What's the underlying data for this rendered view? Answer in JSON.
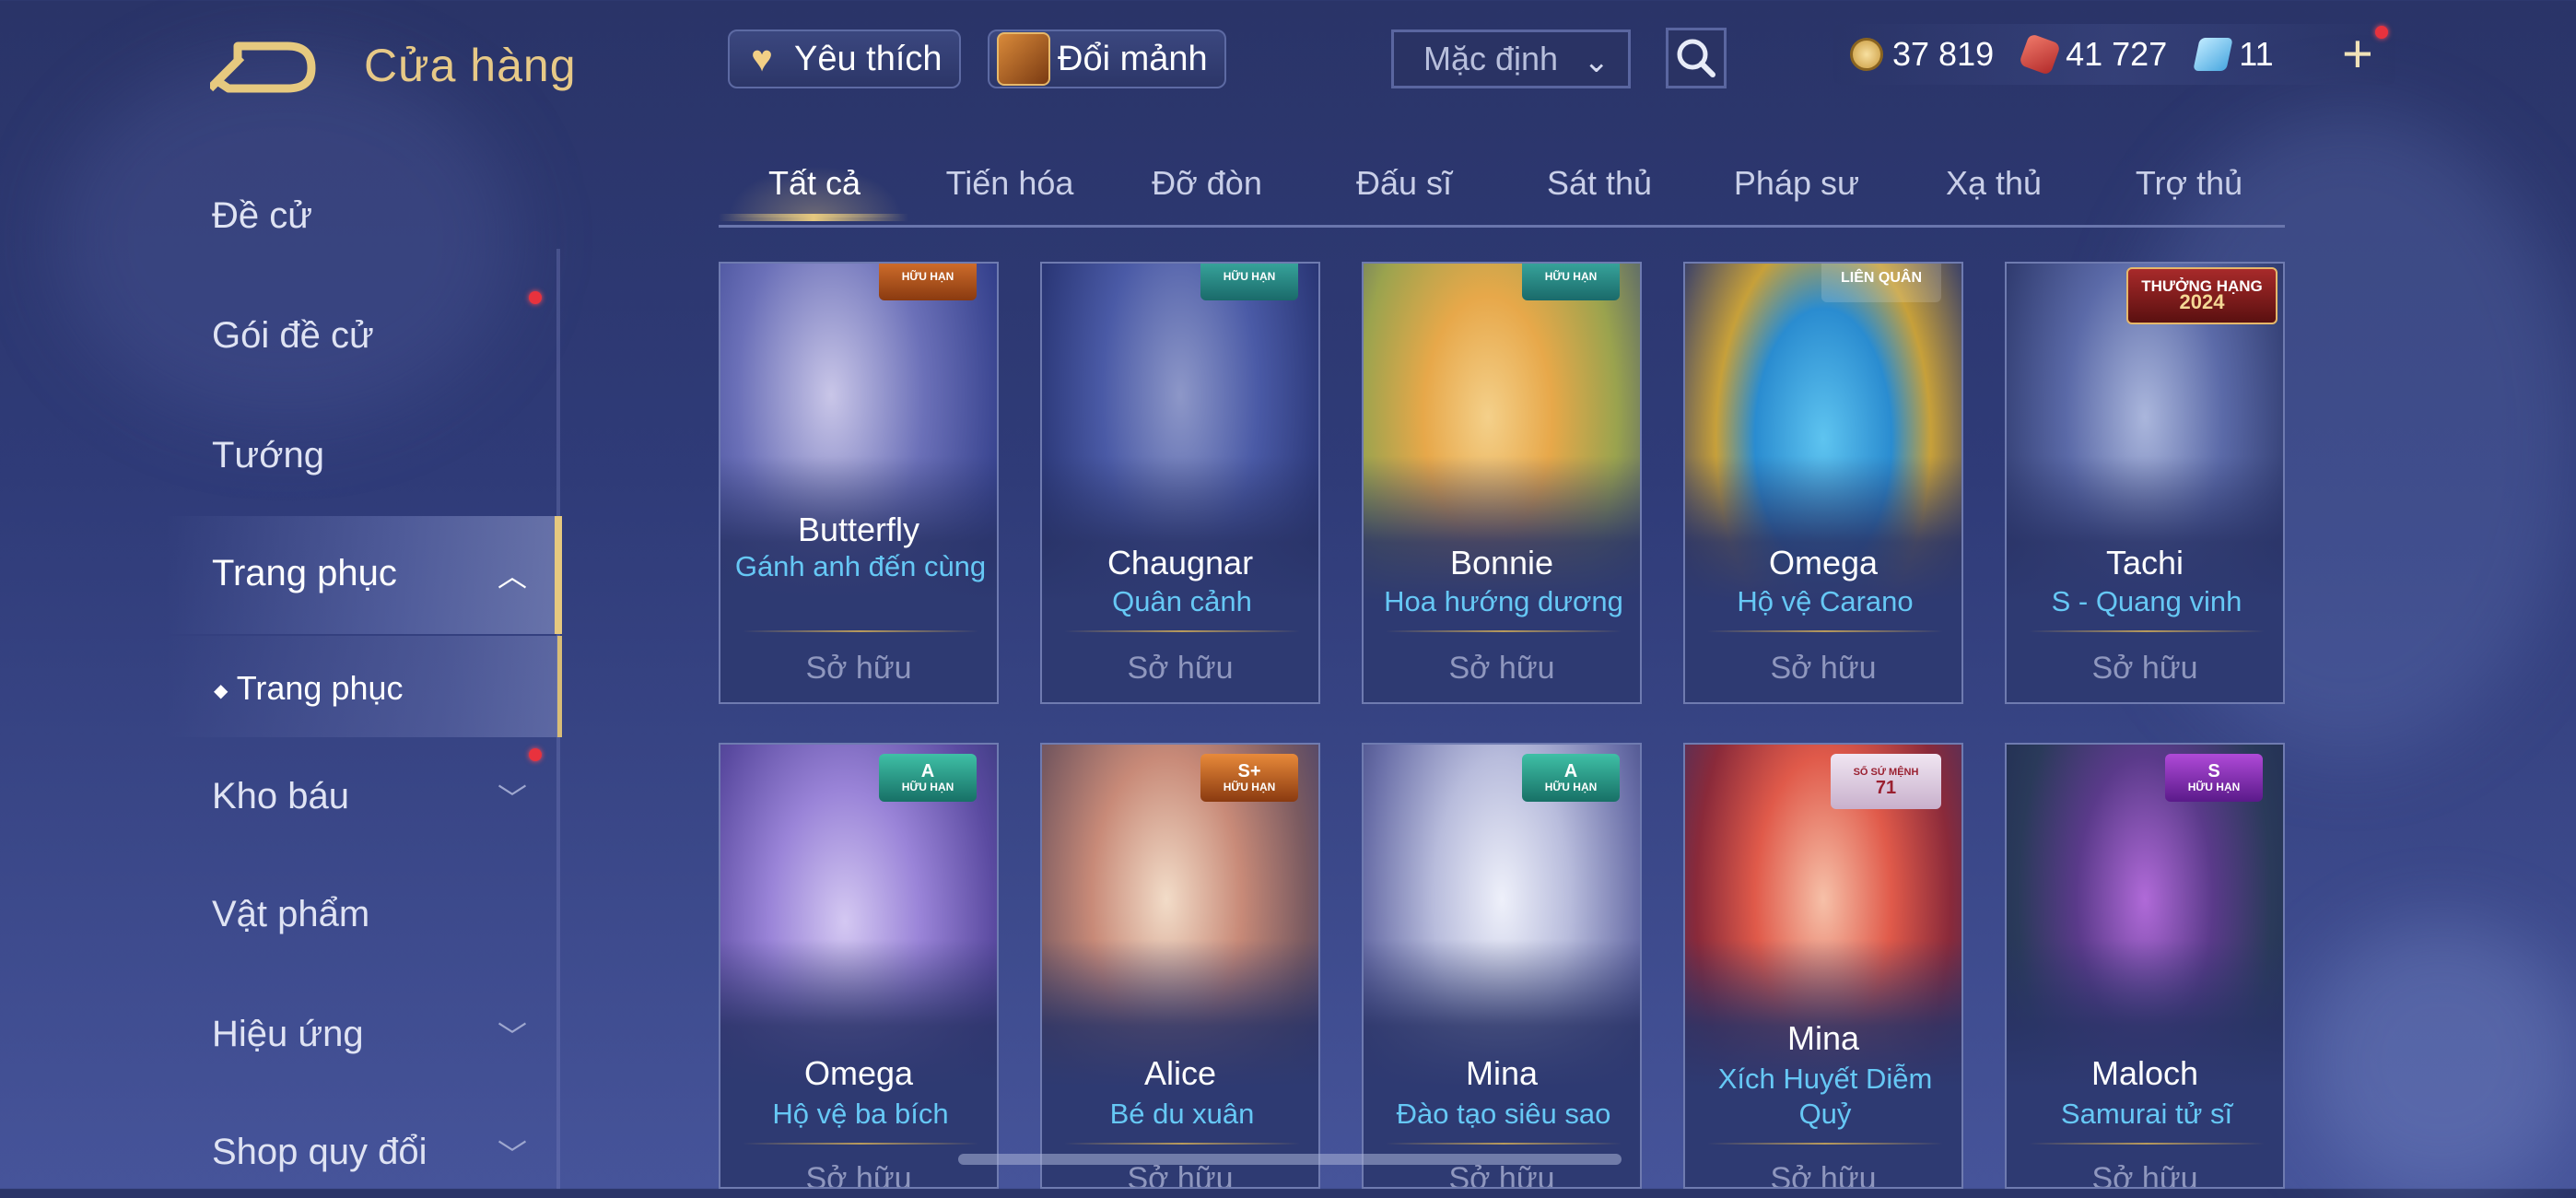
{
  "header": {
    "title": "Cửa hàng",
    "favorite_label": "Yêu thích",
    "exchange_label": "Đổi mảnh",
    "sort_value": "Mặc định"
  },
  "currency": {
    "gold": "37 819",
    "coupons": "41 727",
    "diamonds": "11"
  },
  "sidebar": {
    "items": [
      {
        "label": "Đề cử"
      },
      {
        "label": "Gói đề cử"
      },
      {
        "label": "Tướng"
      },
      {
        "label": "Trang phục"
      },
      {
        "label": "Trang phục"
      },
      {
        "label": "Kho báu"
      },
      {
        "label": "Vật phẩm"
      },
      {
        "label": "Hiệu ứng"
      },
      {
        "label": "Shop quy đổi"
      }
    ]
  },
  "tabs": [
    "Tất cả",
    "Tiến hóa",
    "Đỡ đòn",
    "Đấu sĩ",
    "Sát thủ",
    "Pháp sư",
    "Xạ thủ",
    "Trợ thủ"
  ],
  "cards": [
    {
      "hero": "Butterfly",
      "skin": "Gánh anh đến cùng",
      "status": "Sở hữu",
      "badge_grade": "",
      "badge_text": "HỮU HẠN"
    },
    {
      "hero": "Chaugnar",
      "skin": "Quân cảnh",
      "status": "Sở hữu",
      "badge_grade": "",
      "badge_text": "HỮU HẠN"
    },
    {
      "hero": "Bonnie",
      "skin": "Hoa hướng dương",
      "status": "Sở hữu",
      "badge_grade": "",
      "badge_text": "HỮU HẠN"
    },
    {
      "hero": "Omega",
      "skin": "Hộ vệ Carano",
      "status": "Sở hữu",
      "badge_grade": "",
      "badge_text": "LIÊN QUÂN"
    },
    {
      "hero": "Tachi",
      "skin": "S - Quang vinh",
      "status": "Sở hữu",
      "badge_grade": "THƯỞNG HẠNG",
      "badge_text": "2024"
    },
    {
      "hero": "Omega",
      "skin": "Hộ vệ ba bích",
      "status": "Sở hữu",
      "badge_grade": "A",
      "badge_text": "HỮU HẠN"
    },
    {
      "hero": "Alice",
      "skin": "Bé du xuân",
      "status": "Sở hữu",
      "badge_grade": "S+",
      "badge_text": "HỮU HẠN"
    },
    {
      "hero": "Mina",
      "skin": "Đào tạo siêu sao",
      "status": "Sở hữu",
      "badge_grade": "A",
      "badge_text": "HỮU HẠN"
    },
    {
      "hero": "Mina",
      "skin": "Xích Huyết Diễm Quỷ",
      "status": "Sở hữu",
      "badge_grade": "SỐ SỨ MỆNH",
      "badge_text": "71"
    },
    {
      "hero": "Maloch",
      "skin": "Samurai tử sĩ",
      "status": "Sở hữu",
      "badge_grade": "S",
      "badge_text": "HỮU HẠN"
    }
  ],
  "colors": {
    "accent_gold": "#e6c97f",
    "skin_name": "#66c8f5",
    "notification": "#e8323d"
  },
  "icons": [
    "back-arrow-icon",
    "heart-icon",
    "treasure-box-icon",
    "chevron-down-icon",
    "search-icon",
    "gold-coin-icon",
    "red-coupon-icon",
    "diamond-icon",
    "plus-icon"
  ]
}
